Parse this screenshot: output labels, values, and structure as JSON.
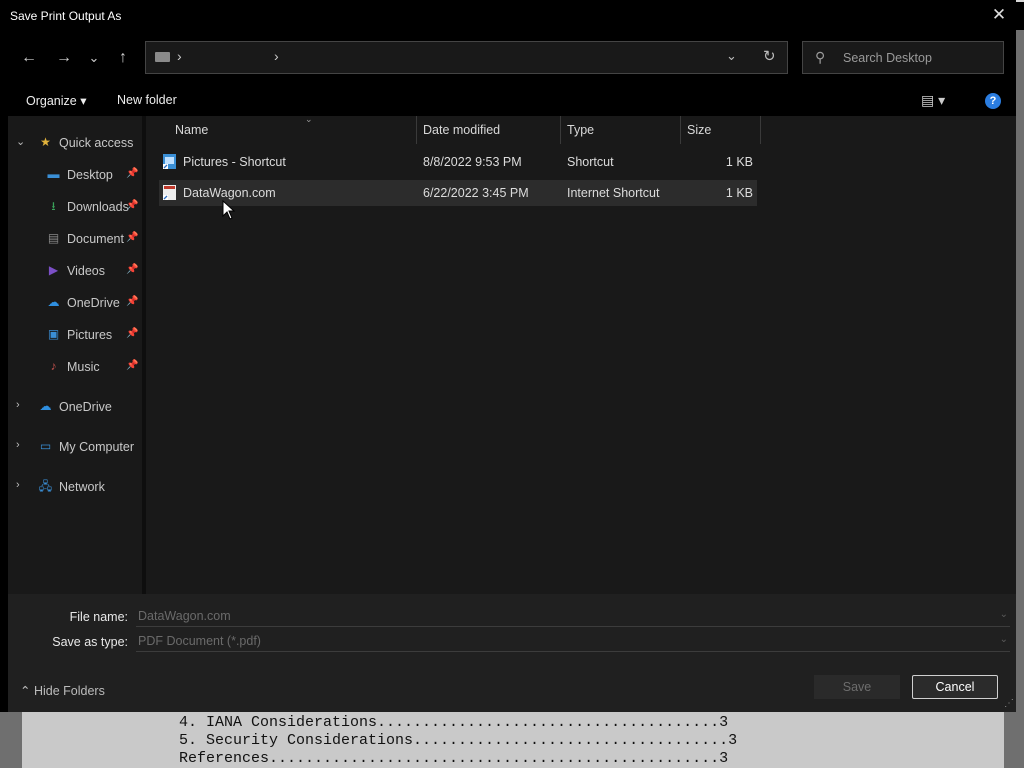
{
  "window": {
    "title": "Save Print Output As",
    "close_glyph": "✕"
  },
  "nav_buttons": {
    "back": "←",
    "forward": "→",
    "recent": "⌄",
    "up": "↑"
  },
  "address": {
    "separator": "›",
    "dropdown_glyph": "⌄",
    "refresh_glyph": "↻"
  },
  "search": {
    "placeholder": "Search Desktop",
    "icon": "search-icon"
  },
  "commands": {
    "organize": "Organize ▾",
    "new_folder": "New folder",
    "view_glyph": "▤ ▾",
    "help_glyph": "?"
  },
  "sidebar": {
    "quick_access": "Quick access",
    "items": [
      {
        "label": "Desktop",
        "icon": "desktop-icon",
        "color": "#3a8fd6",
        "pinned": "📌"
      },
      {
        "label": "Downloads",
        "icon": "download-icon",
        "color": "#3aa35a",
        "pinned": "📌"
      },
      {
        "label": "Documents",
        "icon": "document-icon",
        "color": "#8a8a8a",
        "pinned": "📌"
      },
      {
        "label": "Videos",
        "icon": "video-icon",
        "color": "#7b4fc6",
        "pinned": "📌"
      },
      {
        "label": "OneDrive",
        "icon": "cloud-icon",
        "color": "#2f8fe0",
        "pinned": "📌"
      },
      {
        "label": "Pictures",
        "icon": "pictures-icon",
        "color": "#3a8fd6",
        "pinned": "📌"
      },
      {
        "label": "Music",
        "icon": "music-icon",
        "color": "#c0504d",
        "pinned": "📌"
      }
    ],
    "roots": [
      {
        "label": "OneDrive",
        "icon": "cloud-icon"
      },
      {
        "label": "My Computer",
        "icon": "computer-icon"
      },
      {
        "label": "Network",
        "icon": "network-icon"
      }
    ]
  },
  "columns": [
    "Name",
    "Date modified",
    "Type",
    "Size"
  ],
  "files": [
    {
      "name": "Pictures - Shortcut",
      "date": "8/8/2022 9:53 PM",
      "type": "Shortcut",
      "size": "1 KB",
      "selected": false
    },
    {
      "name": "DataWagon.com",
      "date": "6/22/2022 3:45 PM",
      "type": "Internet Shortcut",
      "size": "1 KB",
      "selected": true
    }
  ],
  "form": {
    "file_name_label": "File name:",
    "file_name_value": "DataWagon.com",
    "save_type_label": "Save as type:",
    "save_type_value": "PDF Document (*.pdf)",
    "hide_folders": "Hide Folders",
    "save": "Save",
    "cancel": "Cancel"
  },
  "background_document": {
    "lines": [
      "4. IANA Considerations......................................3",
      "5. Security Considerations...................................3",
      "References..................................................3"
    ]
  }
}
